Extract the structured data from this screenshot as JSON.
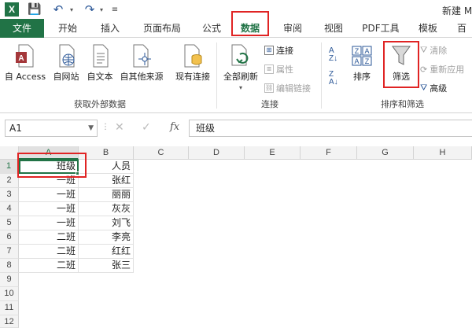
{
  "window": {
    "title": "新建 M"
  },
  "quick_access": {
    "undo_dd": "▾",
    "redo_dd": "▾",
    "customize": "≡"
  },
  "tabs": [
    {
      "label": "文件"
    },
    {
      "label": "开始"
    },
    {
      "label": "插入"
    },
    {
      "label": "页面布局"
    },
    {
      "label": "公式"
    },
    {
      "label": "数据"
    },
    {
      "label": "审阅"
    },
    {
      "label": "视图"
    },
    {
      "label": "PDF工具"
    },
    {
      "label": "模板"
    },
    {
      "label": "百"
    }
  ],
  "ribbon": {
    "get_external": {
      "label": "获取外部数据",
      "from_access": "自 Access",
      "from_web": "自网站",
      "from_text": "自文本",
      "from_other": "自其他来源",
      "existing": "现有连接"
    },
    "connections": {
      "label": "连接",
      "refresh_all": "全部刷新",
      "connections": "连接",
      "properties": "属性",
      "edit_links": "编辑链接"
    },
    "sort_filter": {
      "label": "排序和筛选",
      "sort": "排序",
      "filter": "筛选",
      "clear": "清除",
      "reapply": "重新应用",
      "advanced": "高级"
    }
  },
  "formula_bar": {
    "name_box": "A1",
    "content": "班级"
  },
  "sheet": {
    "columns": [
      "A",
      "B",
      "C",
      "D",
      "E",
      "F",
      "G",
      "H"
    ],
    "rows": [
      "1",
      "2",
      "3",
      "4",
      "5",
      "6",
      "7",
      "8",
      "9",
      "10",
      "11",
      "12"
    ],
    "col_a": [
      "班级",
      "一班",
      "一班",
      "一班",
      "一班",
      "二班",
      "二班",
      "二班"
    ],
    "col_b": [
      "人员",
      "张红",
      "丽丽",
      "灰灰",
      "刘飞",
      "李亮",
      "红红",
      "张三"
    ]
  },
  "colors": {
    "accent": "#217346",
    "highlight": "#e02424"
  }
}
